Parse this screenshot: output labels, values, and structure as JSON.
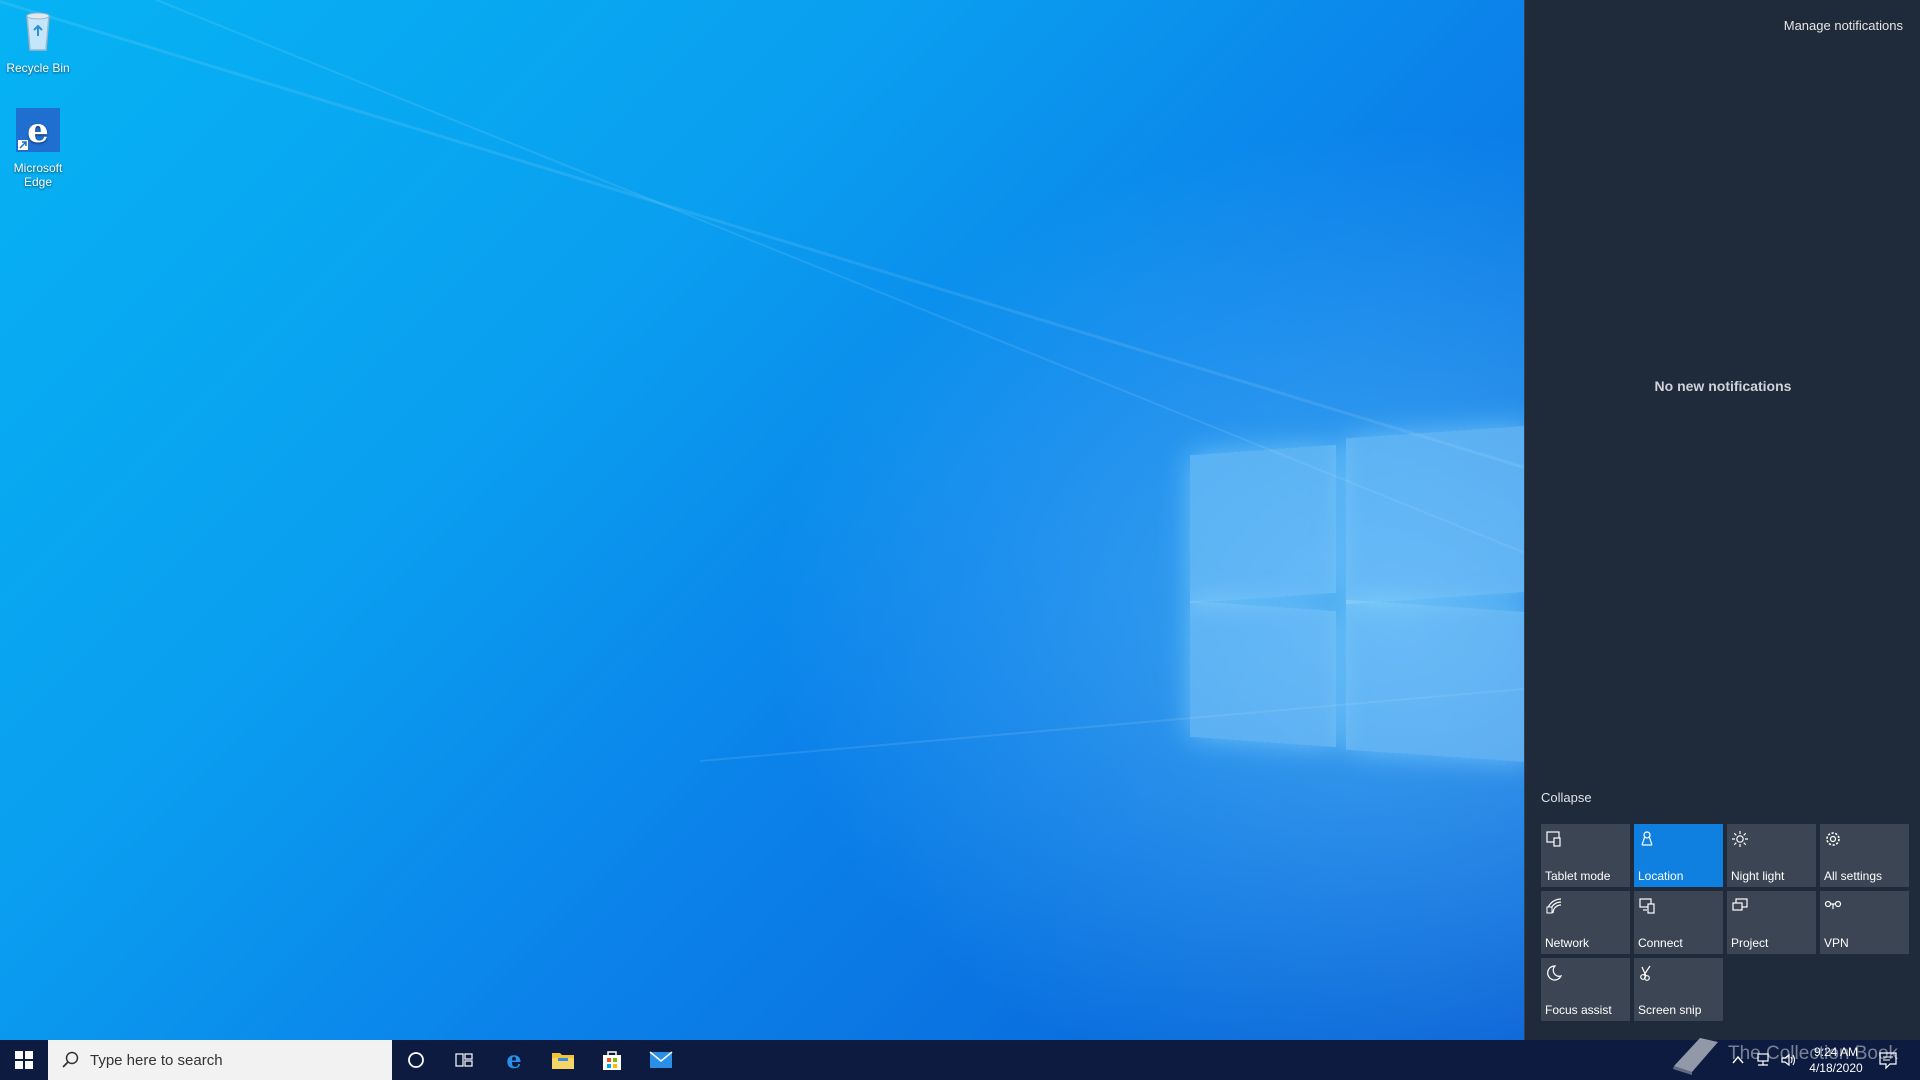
{
  "desktop": {
    "icons": [
      {
        "label": "Recycle Bin"
      },
      {
        "label": "Microsoft Edge"
      }
    ]
  },
  "action_center": {
    "manage_notifications": "Manage notifications",
    "empty_text": "No new notifications",
    "collapse": "Collapse",
    "tiles": [
      {
        "label": "Tablet mode",
        "icon": "tablet-mode-icon",
        "active": false
      },
      {
        "label": "Location",
        "icon": "location-icon",
        "active": true
      },
      {
        "label": "Night light",
        "icon": "night-light-icon",
        "active": false
      },
      {
        "label": "All settings",
        "icon": "gear-icon",
        "active": false
      },
      {
        "label": "Network",
        "icon": "network-icon",
        "active": false
      },
      {
        "label": "Connect",
        "icon": "connect-icon",
        "active": false
      },
      {
        "label": "Project",
        "icon": "project-icon",
        "active": false
      },
      {
        "label": "VPN",
        "icon": "vpn-icon",
        "active": false
      },
      {
        "label": "Focus assist",
        "icon": "moon-icon",
        "active": false
      },
      {
        "label": "Screen snip",
        "icon": "screen-snip-icon",
        "active": false
      }
    ]
  },
  "taskbar": {
    "search_placeholder": "Type here to search",
    "time": "9:24 AM",
    "date": "4/18/2020"
  },
  "watermark": "The Collection Book",
  "colors": {
    "accent": "#0f7fe0",
    "action_center_bg": "#1f2a3a",
    "tile_bg": "#3b4554",
    "taskbar_bg": "#0c1b3f"
  }
}
